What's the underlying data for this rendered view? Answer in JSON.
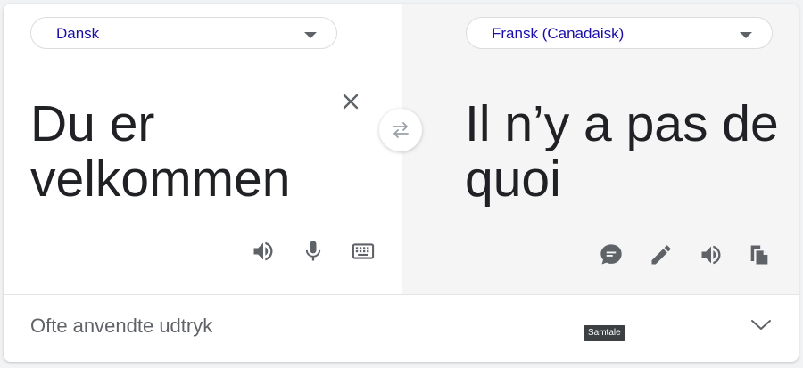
{
  "source": {
    "language": "Dansk",
    "text_line1": "Du er",
    "text_line2": "velkommen"
  },
  "target": {
    "language": "Fransk (Canadaisk)",
    "text_line1": "Il n’y a pas de",
    "text_line2": "quoi"
  },
  "footer": {
    "label": "Ofte anvendte udtryk"
  },
  "tooltip": {
    "text": "Samtale"
  },
  "icons": {
    "clear": "close-icon",
    "swap": "swap-icon",
    "source_listen": "speaker-icon",
    "mic": "microphone-icon",
    "keyboard": "keyboard-icon",
    "conversation": "conversation-icon",
    "edit": "pencil-icon",
    "target_listen": "speaker-icon",
    "copy": "copy-icon",
    "expand": "chevron-down-icon"
  },
  "colors": {
    "language_link": "#1a0dab",
    "icon": "#5f6368",
    "text": "#202124",
    "target_background": "#f5f5f5"
  }
}
